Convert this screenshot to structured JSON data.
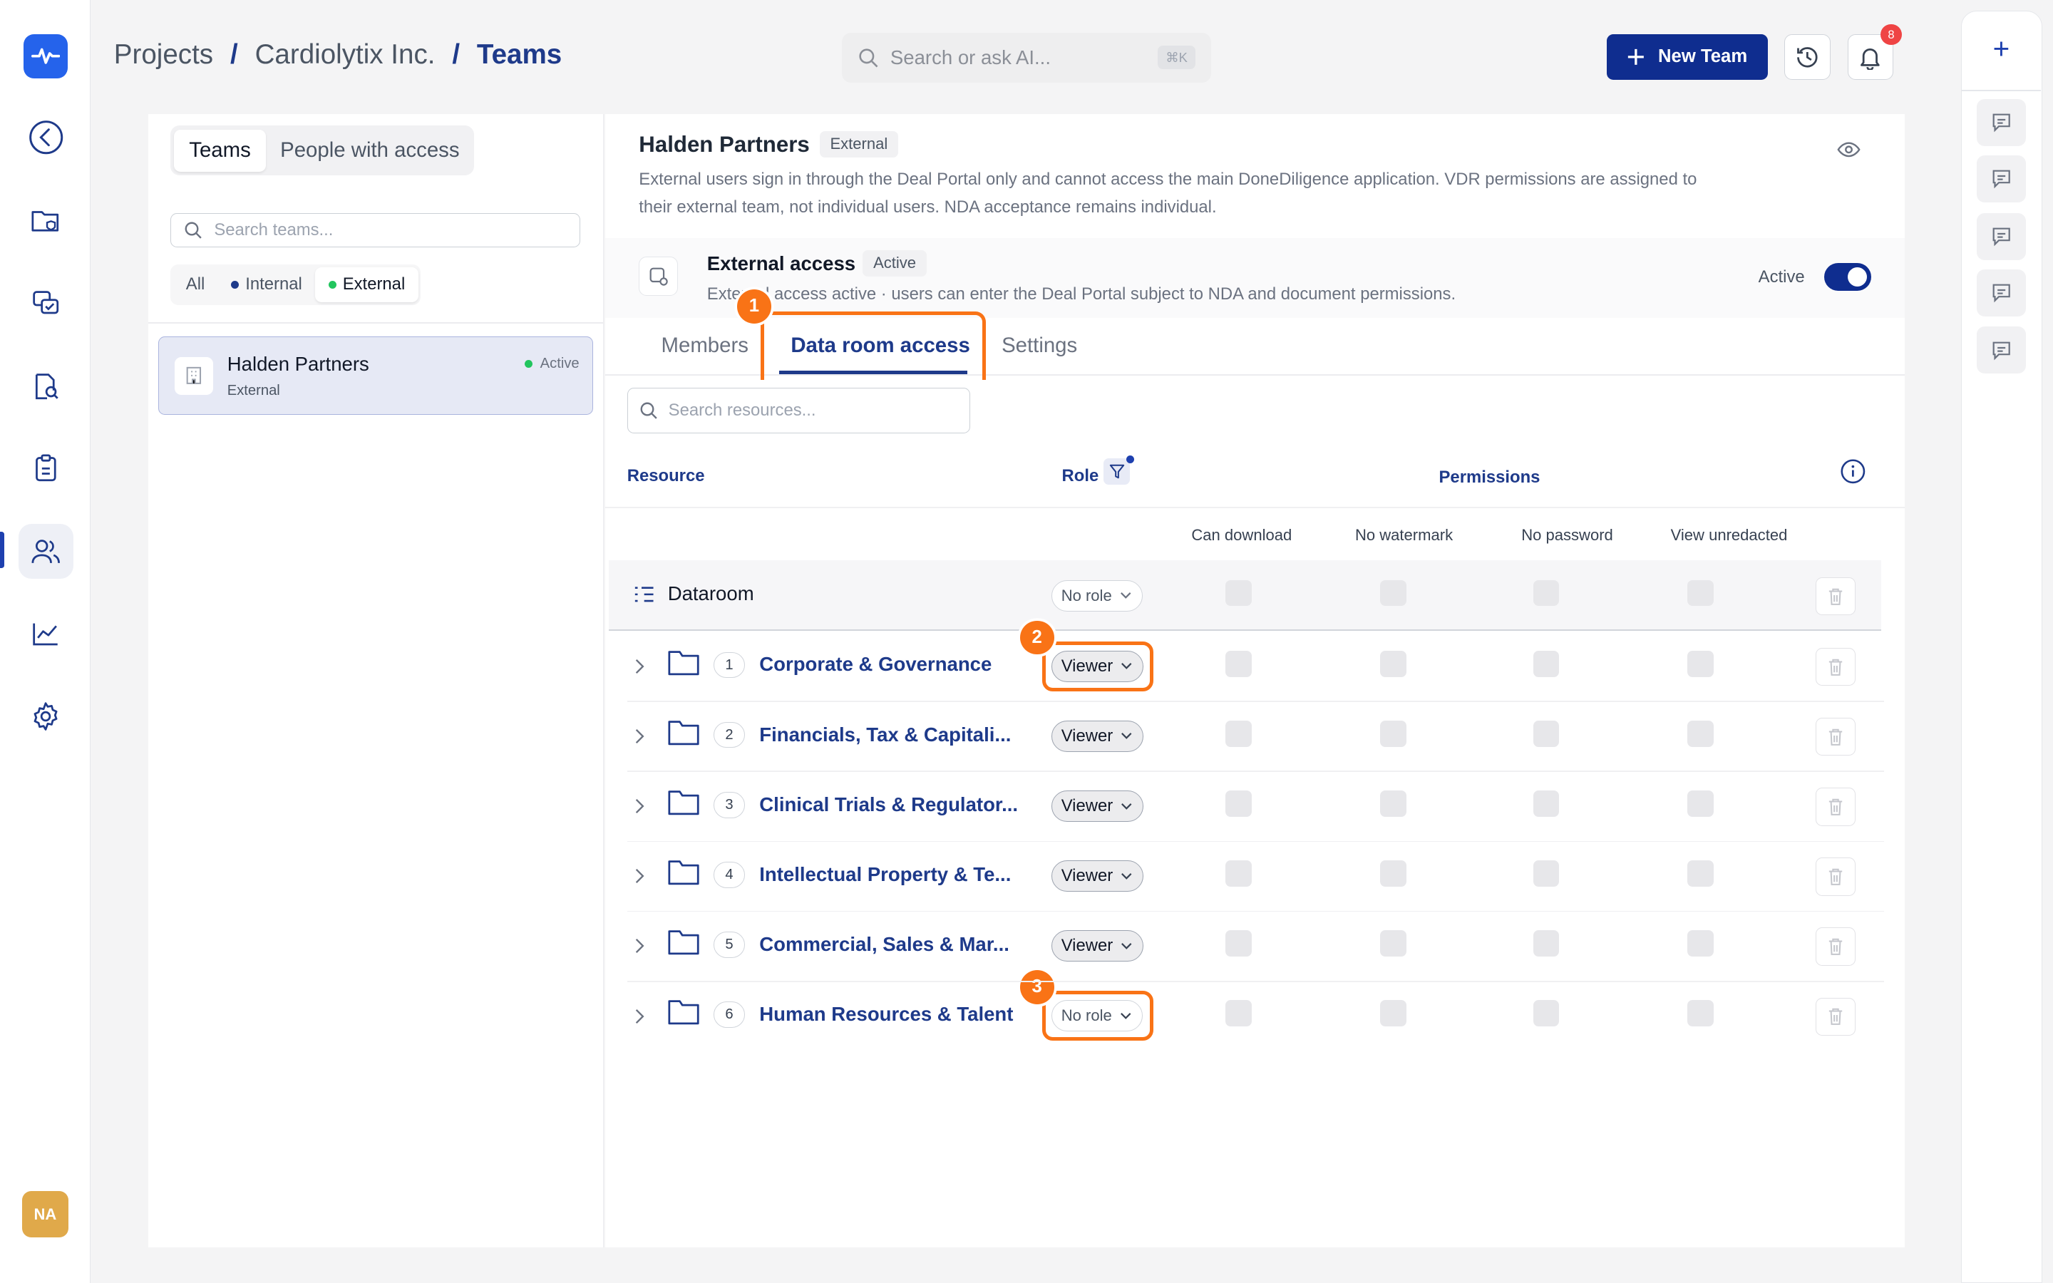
{
  "breadcrumb": {
    "projects": "Projects",
    "company": "Cardiolytix Inc.",
    "current": "Teams",
    "separator": "/"
  },
  "search": {
    "placeholder": "Search or ask AI...",
    "shortcut": "⌘K"
  },
  "header": {
    "new_team_label": "New Team",
    "notification_count": "8"
  },
  "user": {
    "initials": "NA"
  },
  "teams_panel": {
    "tabs": [
      "Teams",
      "People with access"
    ],
    "search_placeholder": "Search teams...",
    "filters": [
      "All",
      "Internal",
      "External"
    ],
    "team": {
      "name": "Halden Partners",
      "type": "External",
      "status": "Active"
    }
  },
  "detail": {
    "title": "Halden Partners",
    "tag": "External",
    "description": "External users sign in through the Deal Portal only and cannot access the main DoneDiligence application. VDR permissions are assigned to their external team, not individual users. NDA acceptance remains individual.",
    "external_access": {
      "title": "External access",
      "tag": "Active",
      "description": "External access active · users can enter the Deal Portal subject to NDA and document permissions.",
      "state_label": "Active"
    },
    "tabs": [
      "Members",
      "Data room access",
      "Settings"
    ],
    "resource_search_placeholder": "Search resources...",
    "columns": {
      "resource": "Resource",
      "role": "Role",
      "permissions": "Permissions"
    },
    "permission_headers": [
      "Can download",
      "No watermark",
      "No password",
      "View unredacted"
    ],
    "dataroom": {
      "name": "Dataroom",
      "role": "No role"
    },
    "rows": [
      {
        "num": "1",
        "name": "Corporate & Governance",
        "role": "Viewer"
      },
      {
        "num": "2",
        "name": "Financials, Tax & Capitali...",
        "role": "Viewer"
      },
      {
        "num": "3",
        "name": "Clinical Trials & Regulator...",
        "role": "Viewer"
      },
      {
        "num": "4",
        "name": "Intellectual Property & Te...",
        "role": "Viewer"
      },
      {
        "num": "5",
        "name": "Commercial, Sales & Mar...",
        "role": "Viewer"
      },
      {
        "num": "6",
        "name": "Human Resources & Talent",
        "role": "No role"
      }
    ]
  },
  "annotations": [
    "1",
    "2",
    "3"
  ],
  "colors": {
    "primary": "#0f2d8f",
    "accent": "#1e3a8a",
    "callout": "#f97316",
    "active_dot": "#22c55e"
  }
}
